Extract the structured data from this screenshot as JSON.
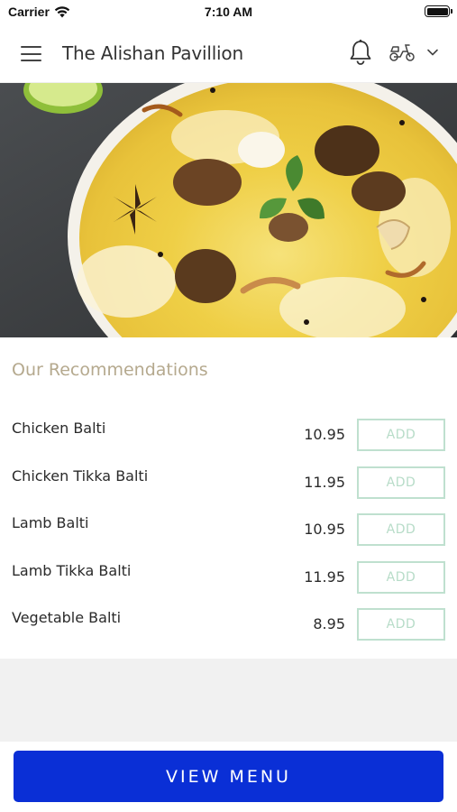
{
  "status_bar": {
    "carrier": "Carrier",
    "time": "7:10 AM"
  },
  "header": {
    "restaurant_name": "The Alishan Pavillion",
    "icons": [
      "menu-icon",
      "bell-icon",
      "scooter-icon",
      "chevron-down-icon"
    ]
  },
  "hero": {
    "image": "biryani-dish-photo"
  },
  "recommendations": {
    "title": "Our Recommendations",
    "items": [
      {
        "name": "Chicken Balti",
        "price": "10.95",
        "button": "ADD"
      },
      {
        "name": "Chicken Tikka Balti",
        "price": "11.95",
        "button": "ADD"
      },
      {
        "name": "Lamb Balti",
        "price": "10.95",
        "button": "ADD"
      },
      {
        "name": "Lamb Tikka Balti",
        "price": "11.95",
        "button": "ADD"
      },
      {
        "name": "Vegetable Balti",
        "price": "8.95",
        "button": "ADD"
      }
    ]
  },
  "footer": {
    "view_menu_label": "VIEW MENU"
  },
  "colors": {
    "primary_button": "#0a2fd6",
    "add_button_border": "#bfe0cf",
    "section_title": "#b5a98e"
  }
}
